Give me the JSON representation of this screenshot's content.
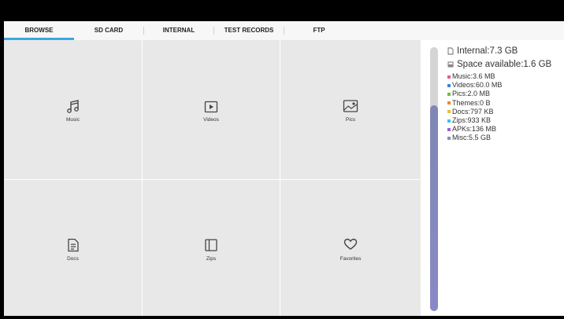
{
  "tabs": [
    {
      "label": "BROWSE",
      "active": true
    },
    {
      "label": "SD CARD",
      "active": false
    },
    {
      "label": "INTERNAL",
      "active": false
    },
    {
      "label": "TEST RECORDS",
      "active": false
    },
    {
      "label": "FTP",
      "active": false
    }
  ],
  "accent_color": "#38a8e0",
  "categories": [
    {
      "label": "Music",
      "icon": "music-note-icon"
    },
    {
      "label": "Videos",
      "icon": "play-icon"
    },
    {
      "label": "Pics",
      "icon": "image-icon"
    },
    {
      "label": "Docs",
      "icon": "document-icon"
    },
    {
      "label": "Zips",
      "icon": "archive-icon"
    },
    {
      "label": "Favorites",
      "icon": "heart-icon"
    }
  ],
  "storage": {
    "internal": "Internal:7.3 GB",
    "space_available": "Space available:1.6 GB",
    "used_fraction": 0.78,
    "items": [
      {
        "label": "Music:3.6 MB",
        "color": "#e85c86"
      },
      {
        "label": "Videos:60.0 MB",
        "color": "#3d82d6"
      },
      {
        "label": "Pics:2.0 MB",
        "color": "#6bbf3c"
      },
      {
        "label": "Themes:0 B",
        "color": "#f08a24"
      },
      {
        "label": "Docs:797 KB",
        "color": "#e0c430"
      },
      {
        "label": "Zips:933 KB",
        "color": "#40c0e0"
      },
      {
        "label": "APKs:136 MB",
        "color": "#a060d0"
      },
      {
        "label": "Misc:5.5 GB",
        "color": "#8890a8"
      }
    ]
  }
}
